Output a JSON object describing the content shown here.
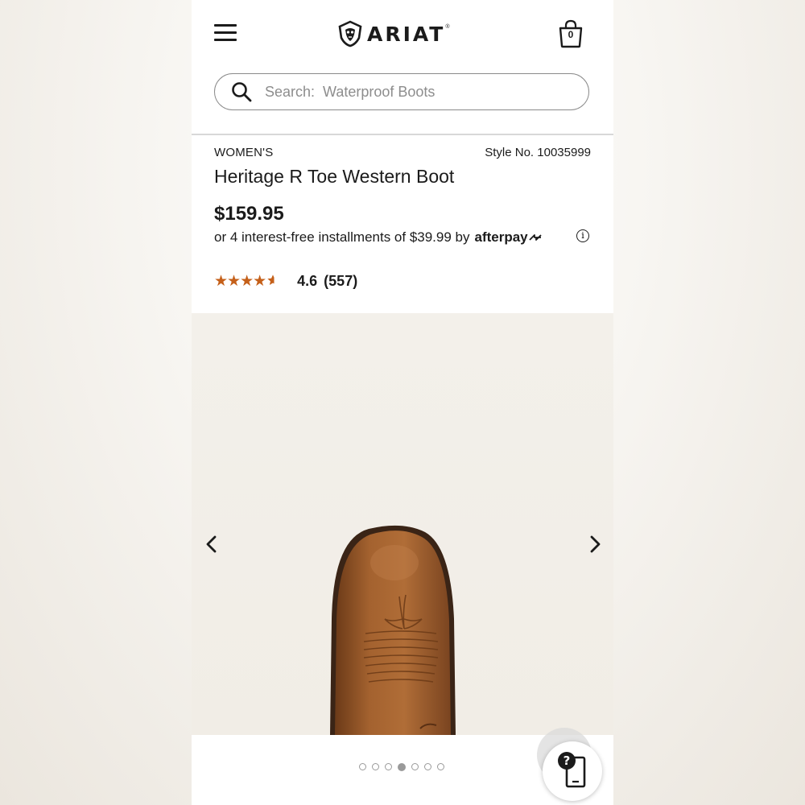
{
  "header": {
    "brand": "ARIAT",
    "trademark": "®",
    "cart_count": "0"
  },
  "search": {
    "placeholder": "Search:  Waterproof Boots"
  },
  "product": {
    "category": "WOMEN'S",
    "style_no": "Style No. 10035999",
    "title": "Heritage R Toe Western Boot",
    "price": "$159.95",
    "installments_text": "or 4 interest-free installments of $39.99 by",
    "afterpay_label": "afterpay",
    "info_glyph": "i",
    "rating_stars": 4.6,
    "stars_glyph": "★★★★",
    "rating_value": "4.6",
    "rating_count": "(557)"
  },
  "gallery": {
    "total_images": 7,
    "active_index": 3
  },
  "help": {
    "glyph": "?"
  },
  "colors": {
    "text": "#1b1b1b",
    "star": "#c5601a",
    "border": "#8a8a8a",
    "boot_leather": "#9a5a2e"
  },
  "icons": [
    "menu-icon",
    "ariat-horse-logo-icon",
    "shopping-bag-icon",
    "search-icon",
    "info-icon",
    "chevron-left-icon",
    "chevron-right-icon",
    "help-chat-icon"
  ]
}
